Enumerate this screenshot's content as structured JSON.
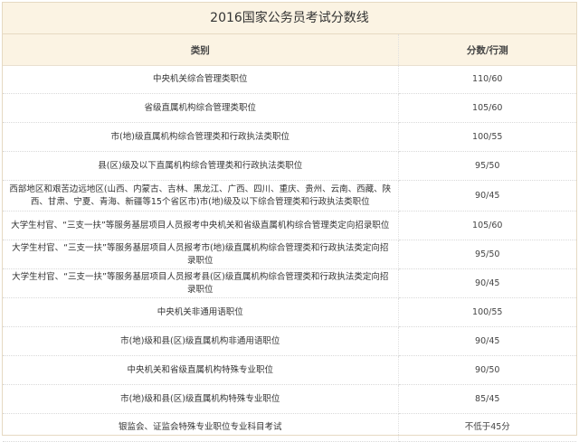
{
  "title": "2016国家公务员考试分数线",
  "headers": [
    "类别",
    "分数/行测"
  ],
  "rows": [
    {
      "category": "中央机关综合管理类职位",
      "score": "110/60"
    },
    {
      "category": "省级直属机构综合管理类职位",
      "score": "105/60"
    },
    {
      "category": "市(地)级直属机构综合管理类和行政执法类职位",
      "score": "100/55"
    },
    {
      "category": "县(区)级及以下直属机构综合管理类和行政执法类职位",
      "score": "95/50"
    },
    {
      "category": "西部地区和艰苦边远地区(山西、内蒙古、吉林、黑龙江、广西、四川、重庆、贵州、云南、西藏、陕西、甘肃、宁夏、青海、新疆等15个省区市)市(地)级及以下综合管理类和行政执法类职位",
      "score": "90/45"
    },
    {
      "category": "大学生村官、“三支一扶”等服务基层项目人员报考中央机关和省级直属机构综合管理类定向招录职位",
      "score": "105/60"
    },
    {
      "category": "大学生村官、“三支一扶”等服务基层项目人员报考市(地)级直属机构综合管理类和行政执法类定向招录职位",
      "score": "95/50"
    },
    {
      "category": "大学生村官、“三支一扶”等服务基层项目人员报考县(区)级直属机构综合管理类和行政执法类定向招录职位",
      "score": "90/45"
    },
    {
      "category": "中央机关非通用语职位",
      "score": "100/55"
    },
    {
      "category": "市(地)级和县(区)级直属机构非通用语职位",
      "score": "90/45"
    },
    {
      "category": "中央机关和省级直属机构特殊专业职位",
      "score": "90/50"
    },
    {
      "category": "市(地)级和县(区)级直属机构特殊专业职位",
      "score": "85/45"
    },
    {
      "category": "银监会、证监会特殊专业职位专业科目考试",
      "score": "不低于45分"
    }
  ]
}
